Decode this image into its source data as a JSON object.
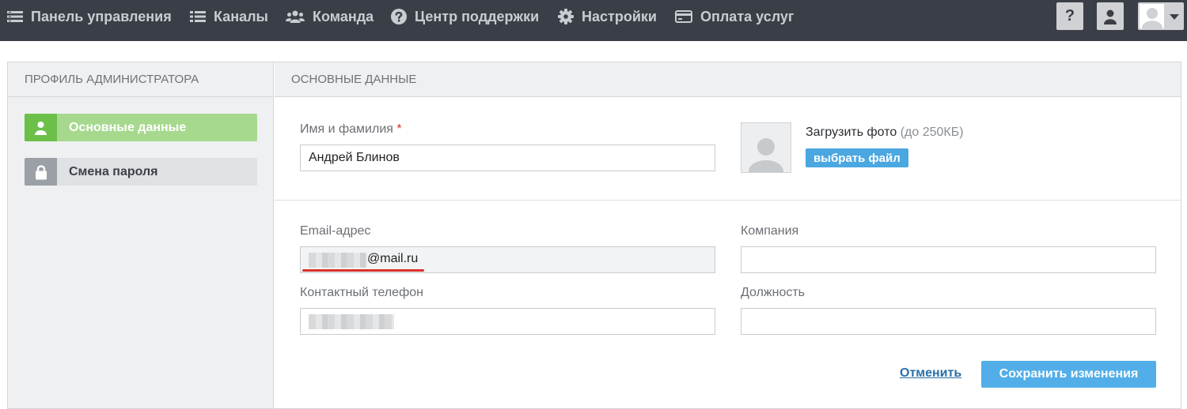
{
  "nav": {
    "items": [
      {
        "label": "Панель управления",
        "icon": "dashboard-icon"
      },
      {
        "label": "Каналы",
        "icon": "list-icon"
      },
      {
        "label": "Команда",
        "icon": "users-icon"
      },
      {
        "label": "Центр поддержки",
        "icon": "question-icon"
      },
      {
        "label": "Настройки",
        "icon": "gear-icon"
      },
      {
        "label": "Оплата услуг",
        "icon": "credit-card-icon"
      }
    ],
    "help_icon": "?",
    "colors": {
      "bar": "#3a3f47",
      "text": "#c9ccd1"
    }
  },
  "sidebar": {
    "header": "ПРОФИЛЬ АДМИНИСТРАТОРА",
    "items": [
      {
        "label": "Основные данные",
        "icon": "user-icon",
        "active": true
      },
      {
        "label": "Смена пароля",
        "icon": "lock-icon",
        "active": false
      }
    ]
  },
  "content": {
    "header": "ОСНОВНЫЕ ДАННЫЕ",
    "name_label": "Имя и фамилия",
    "required_mark": "*",
    "name_value": "Андрей Блинов",
    "upload_label": "Загрузить фото",
    "upload_hint": "(до 250КБ)",
    "choose_file": "выбрать файл",
    "email_label": "Email-адрес",
    "email_suffix": "@mail.ru",
    "company_label": "Компания",
    "company_value": "",
    "phone_label": "Контактный телефон",
    "position_label": "Должность",
    "position_value": "",
    "cancel": "Отменить",
    "save": "Сохранить изменения"
  },
  "colors": {
    "accent_green": "#6cc04a",
    "accent_blue": "#52aee8",
    "link_blue": "#2a6fa8",
    "required_red": "#d9322a"
  }
}
